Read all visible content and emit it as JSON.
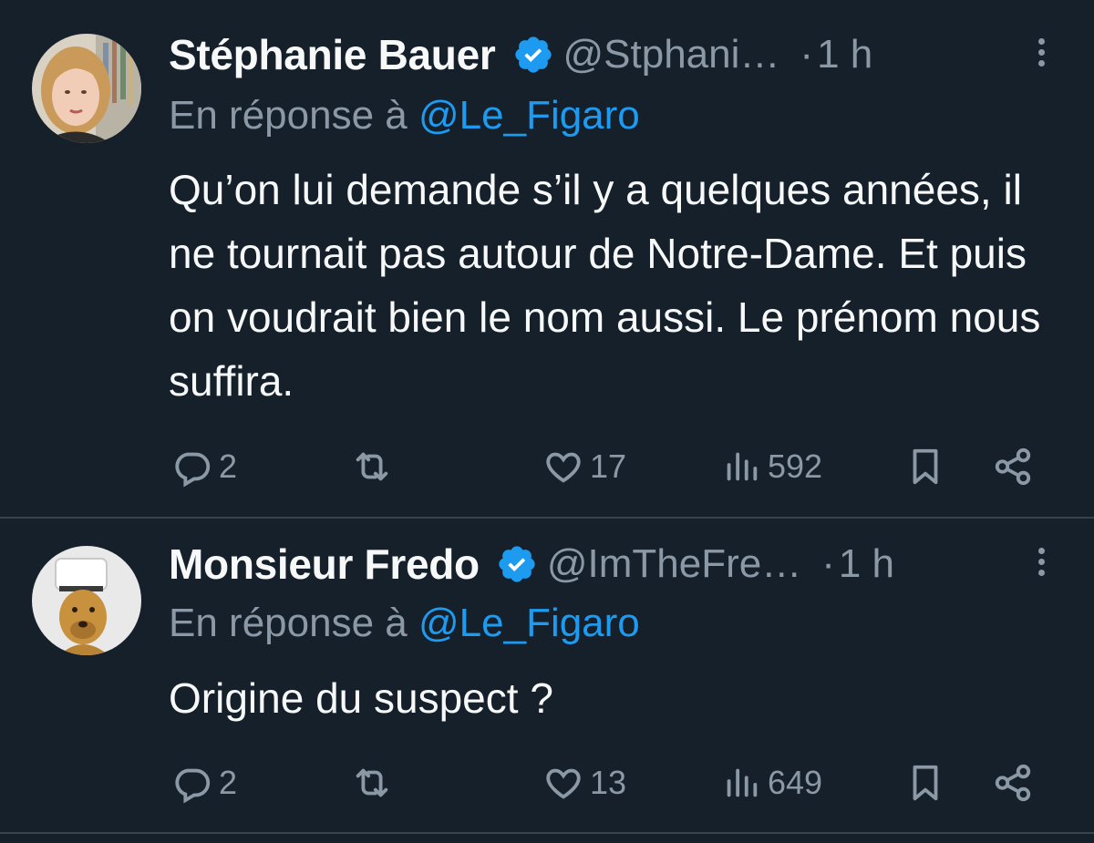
{
  "tweets": [
    {
      "author": {
        "name": "Stéphanie Bauer",
        "handle": "@Stphani…",
        "verified": true
      },
      "separator": "·",
      "time": "1 h",
      "reply_prefix": "En réponse à",
      "reply_to": "@Le_Figaro",
      "text": "Qu’on lui demande s’il y a quelques années, il ne tournait pas autour de Notre-Dame. Et puis on voudrait bien le nom aussi. Le prénom nous suffira.",
      "stats": {
        "replies": "2",
        "likes": "17",
        "views": "592"
      }
    },
    {
      "author": {
        "name": "Monsieur Fredo",
        "handle": "@ImTheFre…",
        "verified": true
      },
      "separator": "·",
      "time": "1 h",
      "reply_prefix": "En réponse à",
      "reply_to": "@Le_Figaro",
      "text": "Origine du suspect ?",
      "stats": {
        "replies": "2",
        "likes": "13",
        "views": "649"
      }
    }
  ],
  "icons": {
    "verified": "verified-badge-icon",
    "reply": "comment-icon",
    "retweet": "retweet-icon",
    "like": "heart-icon",
    "views": "views-bar-chart-icon",
    "bookmark": "bookmark-icon",
    "share": "share-icon",
    "more": "more-vertical-icon"
  },
  "colors": {
    "background": "#15202b",
    "text": "#f7f9f9",
    "muted": "#8b98a5",
    "accent": "#1d9bf0",
    "divider": "#38444d"
  }
}
